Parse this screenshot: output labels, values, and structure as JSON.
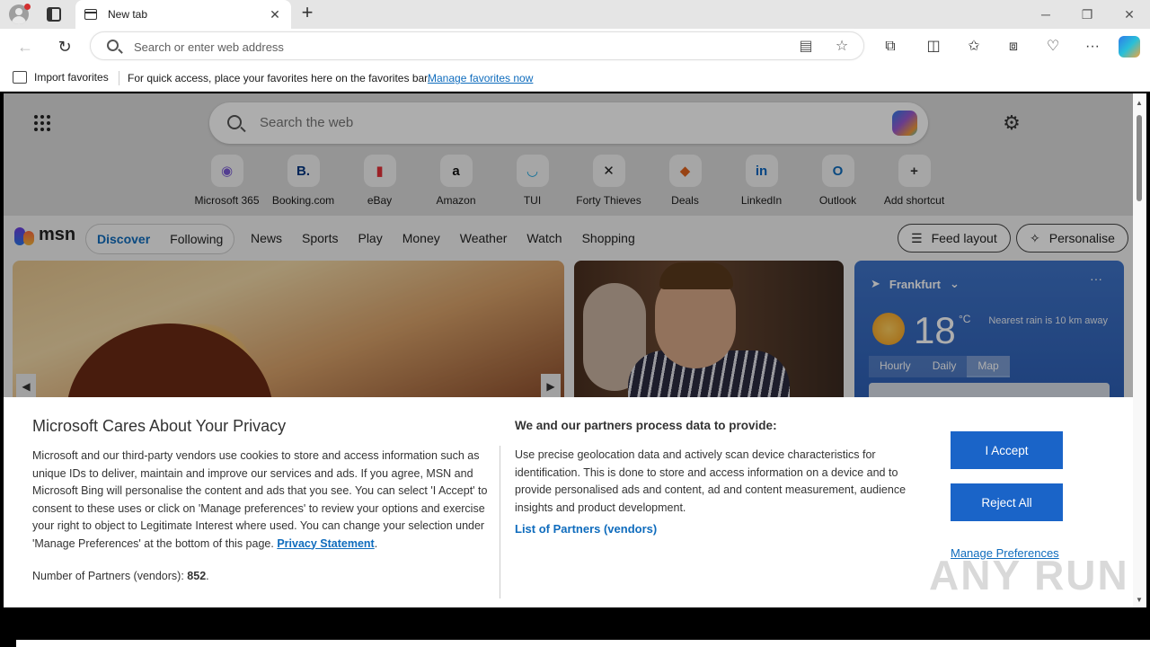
{
  "browser": {
    "tab_title": "New tab",
    "tab_close": "✕",
    "new_tab": "+",
    "address_placeholder": "Search or enter web address",
    "window": {
      "minimize": "─",
      "restore": "❐",
      "close": "✕"
    }
  },
  "favorites_bar": {
    "import_label": "Import favorites",
    "message": "For quick access, place your favorites here on the favorites bar.",
    "manage_link": "Manage favorites now"
  },
  "newtab": {
    "search_placeholder": "Search the web",
    "shortcuts": [
      {
        "label": "Microsoft 365",
        "glyph": "◉",
        "color": "#7b5cd6"
      },
      {
        "label": "Booking.com",
        "glyph": "B.",
        "color": "#003580"
      },
      {
        "label": "eBay",
        "glyph": "▮",
        "color": "#e53238"
      },
      {
        "label": "Amazon",
        "glyph": "a",
        "color": "#111111"
      },
      {
        "label": "TUI",
        "glyph": "◡",
        "color": "#1ba7e0"
      },
      {
        "label": "Forty Thieves",
        "glyph": "✕",
        "color": "#222222"
      },
      {
        "label": "Deals",
        "glyph": "◆",
        "color": "#e0641e"
      },
      {
        "label": "LinkedIn",
        "glyph": "in",
        "color": "#0a66c2"
      },
      {
        "label": "Outlook",
        "glyph": "O",
        "color": "#0f6cbd"
      },
      {
        "label": "Add shortcut",
        "glyph": "+",
        "color": "#333333"
      }
    ]
  },
  "msn": {
    "logo": "msn",
    "pills": [
      "Discover",
      "Following"
    ],
    "nav": [
      "News",
      "Sports",
      "Play",
      "Money",
      "Weather",
      "Watch",
      "Shopping"
    ],
    "feed_layout": "Feed layout",
    "personalise": "Personalise"
  },
  "weather": {
    "location": "Frankfurt",
    "more": "···",
    "temp": "18",
    "unit": "°C",
    "rain": "Nearest rain is 10 km away",
    "tabs": [
      "Hourly",
      "Daily",
      "Map"
    ]
  },
  "privacy": {
    "title": "Microsoft Cares About Your Privacy",
    "body": "Microsoft and our third-party vendors use cookies to store and access information such as unique IDs to deliver, maintain and improve our services and ads. If you agree, MSN and Microsoft Bing will personalise the content and ads that you see. You can select 'I Accept' to consent to these uses or click on 'Manage preferences' to review your options and exercise your right to object to Legitimate Interest where used.  You can change your selection under 'Manage Preferences' at the bottom of this page.",
    "privacy_link": "Privacy Statement",
    "partners_prefix": "Number of Partners (vendors):",
    "partners_count": "852",
    "title2": "We and our partners process data to provide:",
    "body2": "Use precise geolocation data and actively scan device characteristics for identification. This is done to store and access information on a device and to provide personalised ads and content, ad and content measurement, audience insights and product development.",
    "vendors_link": "List of Partners (vendors)",
    "accept": "I Accept",
    "reject": "Reject All",
    "manage": "Manage Preferences"
  },
  "watermark": "ANY RUN"
}
